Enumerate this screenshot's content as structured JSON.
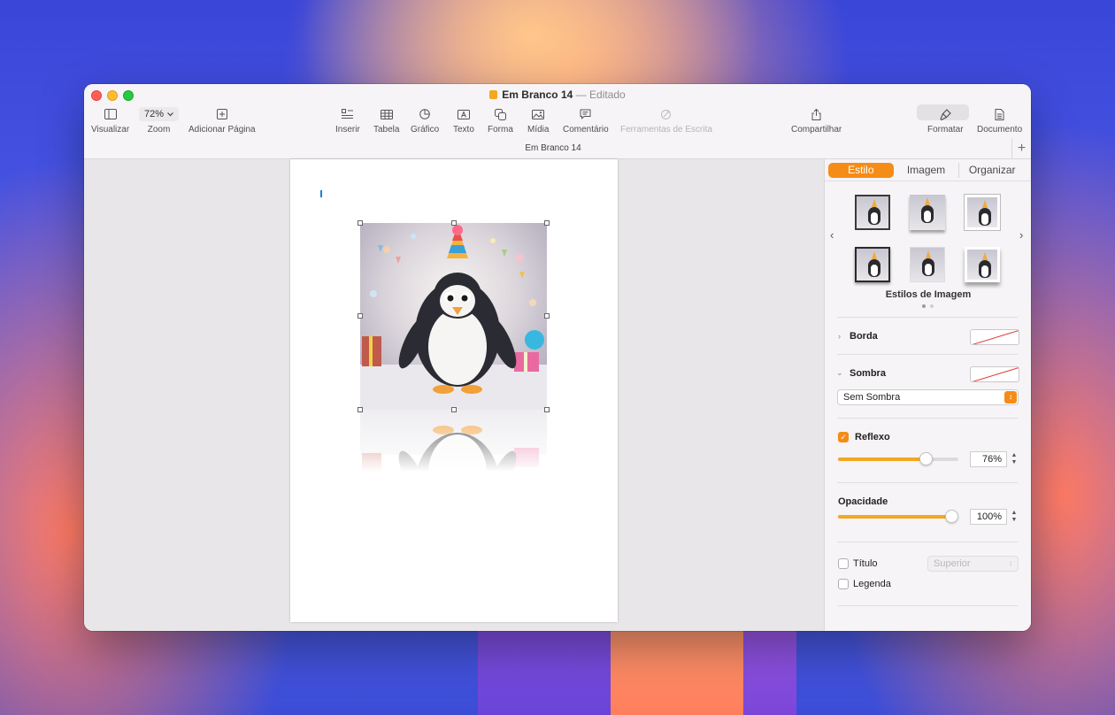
{
  "window": {
    "doc_name": "Em Branco 14",
    "separator": "—",
    "edited_status": "Editado",
    "tab_title": "Em Branco 14"
  },
  "toolbar": {
    "view_label": "Visualizar",
    "zoom_value": "72%",
    "zoom_label": "Zoom",
    "add_page_label": "Adicionar Página",
    "insert_label": "Inserir",
    "table_label": "Tabela",
    "chart_label": "Gráfico",
    "text_label": "Texto",
    "shape_label": "Forma",
    "media_label": "Mídia",
    "comment_label": "Comentário",
    "writing_tools_label": "Ferramentas de Escrita",
    "share_label": "Compartilhar",
    "format_label": "Formatar",
    "document_label": "Documento",
    "add_tab_symbol": "+"
  },
  "inspector": {
    "tabs": [
      "Estilo",
      "Imagem",
      "Organizar"
    ],
    "active_tab": "Estilo",
    "image_styles_title": "Estilos de Imagem",
    "border_label": "Borda",
    "shadow_label": "Sombra",
    "shadow_value": "Sem Sombra",
    "reflection_label": "Reflexo",
    "reflection_checked": true,
    "reflection_value": "76%",
    "reflection_level": 0.76,
    "opacity_label": "Opacidade",
    "opacity_value": "100%",
    "opacity_level": 1.0,
    "title_label": "Título",
    "title_position": "Superior",
    "caption_label": "Legenda"
  },
  "colors": {
    "accent": "#f58c17",
    "slider_fill": "#f5a623"
  }
}
